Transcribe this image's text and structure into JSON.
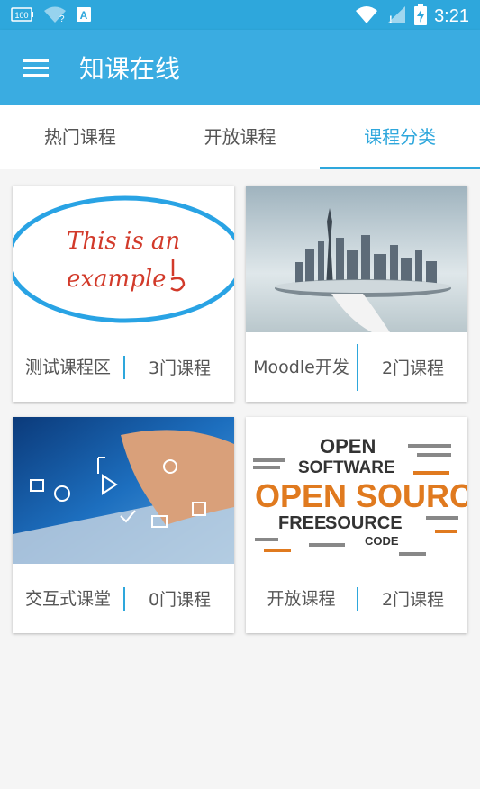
{
  "status_bar": {
    "battery_saver_label": "100",
    "time": "3:21"
  },
  "app_bar": {
    "title": "知课在线",
    "menu_icon": "hamburger-menu-icon"
  },
  "tabs": [
    {
      "label": "热门课程",
      "active": false
    },
    {
      "label": "开放课程",
      "active": false
    },
    {
      "label": "课程分类",
      "active": true
    }
  ],
  "categories": [
    {
      "name": "测试课程区",
      "count": "3门课程",
      "image": "handwriting-example-icon",
      "image_text": [
        "This is an",
        "example"
      ]
    },
    {
      "name": "Moodle开发",
      "count": "2门课程",
      "image": "city-on-tray-photo"
    },
    {
      "name": "交互式课堂",
      "count": "0门课程",
      "image": "tablet-touch-photo"
    },
    {
      "name": "开放课程",
      "count": "2门课程",
      "image": "open-source-wordcloud",
      "image_text": [
        "OPEN",
        "SOFTWARE",
        "OPEN SOURCE",
        "FREE",
        "SOURCE",
        "CODE"
      ]
    }
  ],
  "colors": {
    "primary": "#3aace1",
    "status_bar": "#2ea7dc",
    "accent": "#2ea7dc",
    "background": "#f5f5f5"
  }
}
